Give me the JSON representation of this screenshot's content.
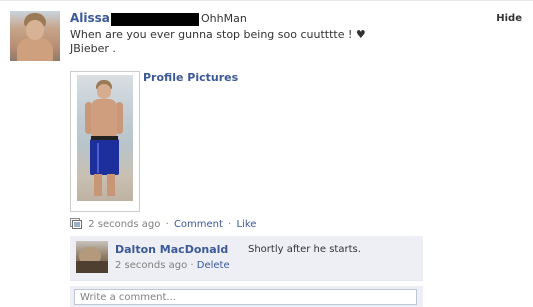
{
  "post": {
    "author": "Alissa",
    "author_suffix": "OhhMan",
    "hide_label": "Hide",
    "message_line1": "When are you ever gunna stop being soo cuutttte ! ♥",
    "message_line2": "JBieber ."
  },
  "attachment": {
    "album_title": "Profile Pictures"
  },
  "meta": {
    "timestamp": "2 seconds ago",
    "separator": "·",
    "comment_label": "Comment",
    "like_label": "Like"
  },
  "comment": {
    "author": "Dalton MacDonald",
    "text": "Shortly after he starts.",
    "timestamp": "2 seconds ago",
    "separator": "·",
    "delete_label": "Delete"
  },
  "composer": {
    "placeholder": "Write a comment..."
  },
  "colors": {
    "link_blue": "#3b5998",
    "comment_bg": "#edeff4",
    "meta_gray": "#808080"
  },
  "icons": {
    "meta_icon": "photo-album-icon"
  }
}
